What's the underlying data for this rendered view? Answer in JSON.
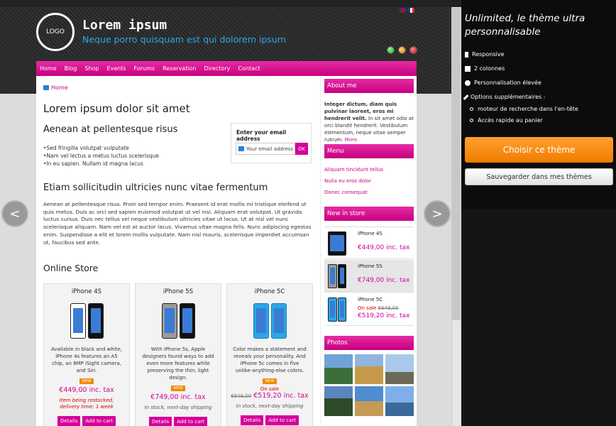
{
  "header": {
    "logo": "LOGO",
    "title": "Lorem ipsum",
    "tagline": "Neque porro quisquam est qui dolorem ipsum"
  },
  "nav": [
    "Home",
    "Blog",
    "Shop",
    "Events",
    "Forums",
    "Reservation",
    "Directory",
    "Contact"
  ],
  "breadcrumb": "Home",
  "main": {
    "title": "Lorem ipsum dolor sit amet",
    "subtitle": "Aenean at pellentesque risus",
    "bullets": [
      "Sed fringilla volutpat vulputate",
      "Nam vel lectus a metus luctus scelerisque",
      "In eu sapien. Nullam id magna lacus"
    ],
    "newsletter": {
      "title": "Enter your email address",
      "placeholder": "Your email address",
      "ok": "OK"
    },
    "section_title": "Etiam sollicitudin ultricies nunc vitae fermentum",
    "paragraph": "Aenean at pellentesque risus. Proin sed tempor enim. Praesent id erat mollis mi tristique eleifend ut quis metus. Duis ac orci sed sapien euismod volutpat ut vel nisi. Aliquam erat volutpat. Ut gravida luctus cursus. Duis nec tellus vel neque vestibulum ultricies vitae ut lacus. Ut at nisl vel nunc scelerisque aliquam. Nam vel est at auctor lacus. Vivamus vitae magna felis. Nunc adipiscing egestas enim. Suspendisse a elit et lorem mollis vulputate. Nam nisl mauris, scelerisque imperdiet accumsan ut, faucibus sed ante.",
    "store_title": "Online Store"
  },
  "products": [
    {
      "name": "iPhone 4S",
      "desc": "Available in black and white, iPhone 4s features an A5 chip, an 8MP iSight camera, and Siri.",
      "badge": "NEW",
      "price": "€449,00 inc. tax",
      "avail": "Item being restocked, delivery time: 1 week",
      "details": "Details",
      "cart": "Add to cart"
    },
    {
      "name": "iPhone 5S",
      "desc": "With iPhone 5s, Apple designers found ways to add even more features while preserving the thin, light design.",
      "badge": "NEW",
      "price": "€749,00 inc. tax",
      "avail": "In stock, next-day shipping",
      "details": "Details",
      "cart": "Add to cart"
    },
    {
      "name": "iPhone 5C",
      "desc": "Color makes a statement and reveals your personality. And iPhone 5c comes in five unlike-anything-else colors.",
      "badge": "NEW",
      "onsale": "On sale",
      "oldprice": "€649,00",
      "price": "€519,20 inc. tax",
      "avail": "In stock, next-day shipping",
      "details": "Details",
      "cart": "Add to cart"
    }
  ],
  "sidebar": {
    "about_title": "About me",
    "about_bold": "Integer dictum, diam quis pulvinar laoreet, eros mi hendrerit velit.",
    "about_text": "In sit amet odio at orci blandit hendrerit. Vestibulum elementum, neque vitae semper rutrum.",
    "about_more": "More.",
    "menu_title": "Menu",
    "menu_items": [
      "Aliquam tincidunt tellus",
      "Nulla eu eros dolor",
      "Donec consequat"
    ],
    "new_title": "New in store",
    "new_items": [
      {
        "name": "iPhone 4S",
        "price": "€449,00 inc. tax"
      },
      {
        "name": "iPhone 5S",
        "price": "€749,00 inc. tax"
      },
      {
        "name": "iPhone 5C",
        "onsale": "On sale",
        "oldprice": "€649,00",
        "price": "€519,20 inc. tax"
      }
    ],
    "photos_title": "Photos"
  },
  "panel": {
    "title": "Unlimited, le thème ultra personnalisable",
    "features": [
      "Responsive",
      "2 colonnes",
      "Personnalisation élevée",
      "Options supplémentaires :"
    ],
    "sub_features": [
      "moteur de recherche dans l'en-tête",
      "Accès rapide au panier"
    ],
    "choose": "Choisir ce thème",
    "save": "Sauvegarder dans mes thèmes"
  },
  "arrows": {
    "prev": "<",
    "next": ">"
  },
  "colors": {
    "accent": "#d4009a",
    "orange": "#f07d00",
    "link_blue": "#2aa6e8"
  }
}
